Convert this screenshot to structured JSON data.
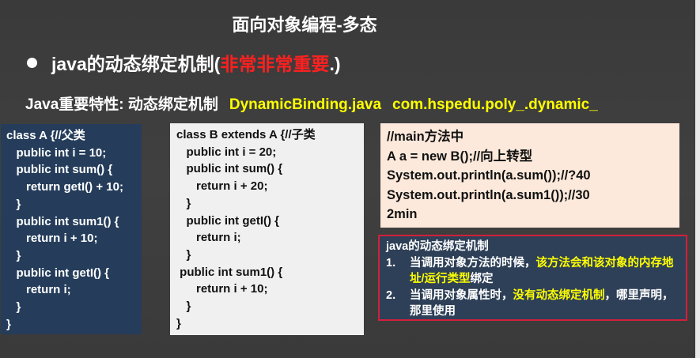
{
  "slide": {
    "title": "面向对象编程-多态",
    "bullet": {
      "prefix": "java的动态绑定机制(",
      "highlight": "非常非常重要",
      "suffix": ".)"
    },
    "feature": {
      "label": "Java重要特性: 动态绑定机制",
      "file": "DynamicBinding.java",
      "package": "com.hspedu.poly_.dynamic_"
    },
    "class_a_code": "class A {//父类\n   public int i = 10;\n   public int sum() {\n      return getI() + 10;\n   }\n   public int sum1() {\n      return i + 10;\n   }\n   public int getI() {\n      return i;\n   }\n}",
    "class_b_code": "class B extends A {//子类\n   public int i = 20;\n   public int sum() {\n      return i + 20;\n   }\n   public int getI() {\n      return i;\n   }\n public int sum1() {\n      return i + 10;\n   }\n}",
    "main_code": "//main方法中\nA a = new B();//向上转型\nSystem.out.println(a.sum());//?40\nSystem.out.println(a.sum1());//30\n2min",
    "note": {
      "heading": "java的动态绑定机制",
      "item1_num": "1.",
      "item1_text": "当调用对象方法的时候，",
      "item1_highlight": "该方法会和该对象的内存地址/运行类型",
      "item1_suffix": "绑定",
      "item2_num": "2.",
      "item2_text": "当调用对象属性时，",
      "item2_highlight": "没有动态绑定机制",
      "item2_suffix": "，哪里声明，那里使用"
    }
  },
  "colors": {
    "background": "#3c3c3c",
    "emphasis_red": "#ff2020",
    "highlight_yellow": "#ffff00",
    "class_a_bg": "#253d5b",
    "class_b_bg": "#f0f0f0",
    "main_bg": "#fce9db",
    "note_bg": "#2e4058",
    "note_border": "#d21f3c"
  }
}
